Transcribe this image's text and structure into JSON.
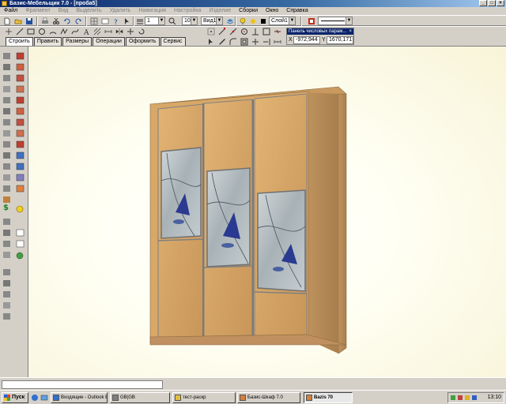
{
  "window": {
    "title": "Базис-Мебельщик 7.0 - [проба5]"
  },
  "menu": [
    {
      "label": "Файл",
      "enabled": true
    },
    {
      "label": "Фрагмент",
      "enabled": false
    },
    {
      "label": "Вид",
      "enabled": false
    },
    {
      "label": "Выделить",
      "enabled": false
    },
    {
      "label": "Удалить",
      "enabled": false
    },
    {
      "label": "Навигация",
      "enabled": false
    },
    {
      "label": "Настройка",
      "enabled": false
    },
    {
      "label": "Изделие",
      "enabled": false
    },
    {
      "label": "Сборки",
      "enabled": true
    },
    {
      "label": "Окно",
      "enabled": true
    },
    {
      "label": "Справка",
      "enabled": true
    }
  ],
  "toolbar": {
    "line_width_value": "1",
    "zoom_value": "10",
    "view_value": "Вид1",
    "layer_value": "Слой1",
    "combo_arrow": "▼"
  },
  "tabs": [
    {
      "label": "Строить",
      "active": true
    },
    {
      "label": "Править",
      "active": false
    },
    {
      "label": "Размеры",
      "active": false
    },
    {
      "label": "Операции",
      "active": false
    },
    {
      "label": "Оформить",
      "active": false
    },
    {
      "label": "Сервис",
      "active": false
    }
  ],
  "numeric_panel": {
    "title": "Панель числовых парам...",
    "close_glyph": "×",
    "x_label": "X",
    "x_value": "-972,944",
    "y_label": "Y",
    "y_value": "1670,171"
  },
  "taskbar": {
    "start_label": "Пуск",
    "items": [
      {
        "label": "Входящие - Outlook Exp...",
        "active": false
      },
      {
        "label": "GB|GB",
        "active": false
      },
      {
        "label": "тест-раскр",
        "active": false
      },
      {
        "label": "Базис-Шкаф 7.0",
        "active": false
      },
      {
        "label": "Bazis 70",
        "active": true
      }
    ],
    "clock": "13:10"
  },
  "colors": {
    "titlebar": "#0a246a",
    "wood_light": "#d8a868",
    "wood_side": "#b88c58",
    "frame_metal": "#8a8a8a",
    "mirror": "#b8c0c4",
    "decor_blue": "#2a3a90"
  }
}
